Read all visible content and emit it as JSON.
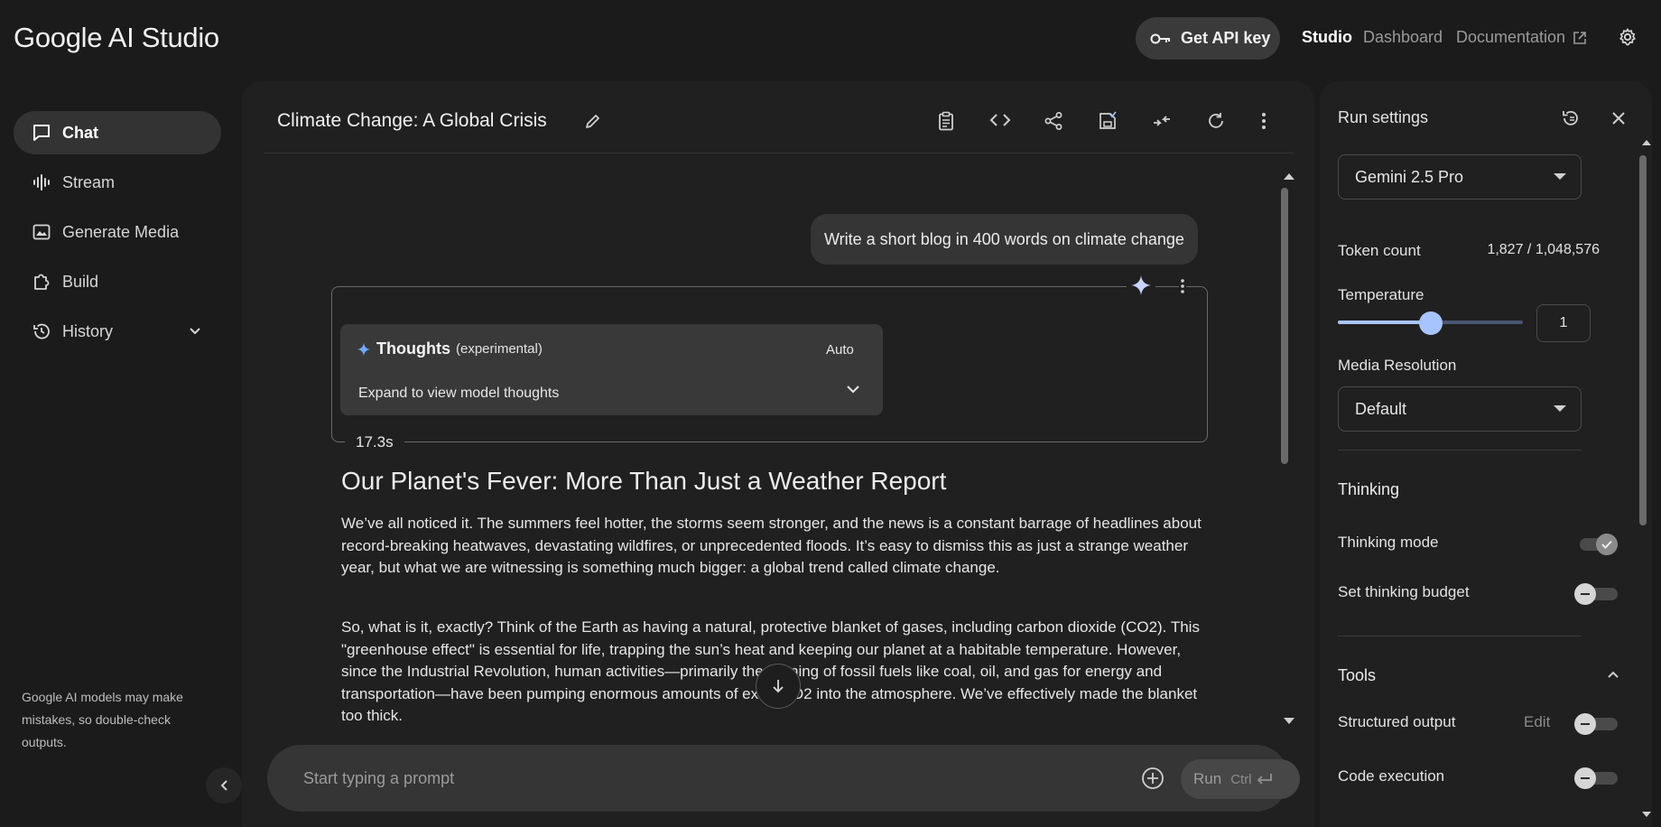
{
  "app": {
    "logo": "Google AI Studio",
    "api_key_label": "Get API key",
    "nav": {
      "studio": "Studio",
      "dashboard": "Dashboard",
      "documentation": "Documentation"
    }
  },
  "sidebar": {
    "items": [
      {
        "label": "Chat",
        "icon": "chat-icon",
        "active": true
      },
      {
        "label": "Stream",
        "icon": "waveform-icon"
      },
      {
        "label": "Generate Media",
        "icon": "image-icon"
      },
      {
        "label": "Build",
        "icon": "puzzle-icon"
      },
      {
        "label": "History",
        "icon": "history-icon"
      }
    ],
    "note": "Google AI models may make mistakes, so double-check outputs."
  },
  "chat": {
    "title": "Climate Change: A Global Crisis",
    "user_message": "Write a short blog in 400 words on climate change",
    "thoughts": {
      "title": "Thoughts",
      "tag": "(experimental)",
      "mode": "Auto",
      "expand_label": "Expand to view model thoughts"
    },
    "elapsed": "17.3s",
    "response": {
      "heading": "Our Planet's Fever: More Than Just a Weather Report",
      "paragraphs": [
        "We’ve all noticed it. The summers feel hotter, the storms seem stronger, and the news is a constant barrage of headlines about record-breaking heatwaves, devastating wildfires, or unprecedented floods. It’s easy to dismiss this as just a strange weather year, but what we are witnessing is something much bigger: a global trend called climate change.",
        "So, what is it, exactly? Think of the Earth as having a natural, protective blanket of gases, including carbon dioxide (CO2). This \"greenhouse effect\" is essential for life, trapping the sun’s heat and keeping our planet at a habitable temperature. However, since the Industrial Revolution, human activities—primarily the burning of fossil fuels like coal, oil, and gas for energy and transportation—have been pumping enormous amounts of extra CO2 into the atmosphere. We’ve effectively made the blanket too thick."
      ]
    },
    "prompt_placeholder": "Start typing a prompt",
    "run_label": "Run",
    "run_shortcut": "Ctrl"
  },
  "run_settings": {
    "title": "Run settings",
    "model": "Gemini 2.5 Pro",
    "token_count_label": "Token count",
    "token_count_value": "1,827 / 1,048,576",
    "temperature_label": "Temperature",
    "temperature_value": "1",
    "temperature_fraction": 0.5,
    "media_resolution_label": "Media Resolution",
    "media_resolution_value": "Default",
    "thinking_section": "Thinking",
    "thinking_mode_label": "Thinking mode",
    "thinking_mode_on": true,
    "thinking_budget_label": "Set thinking budget",
    "thinking_budget_on": false,
    "tools_section": "Tools",
    "structured_output_label": "Structured output",
    "structured_output_edit": "Edit",
    "code_execution_label": "Code execution"
  },
  "colors": {
    "accent": "#a8c4ff",
    "bg": "#1b1b1b",
    "panel": "#202020"
  }
}
